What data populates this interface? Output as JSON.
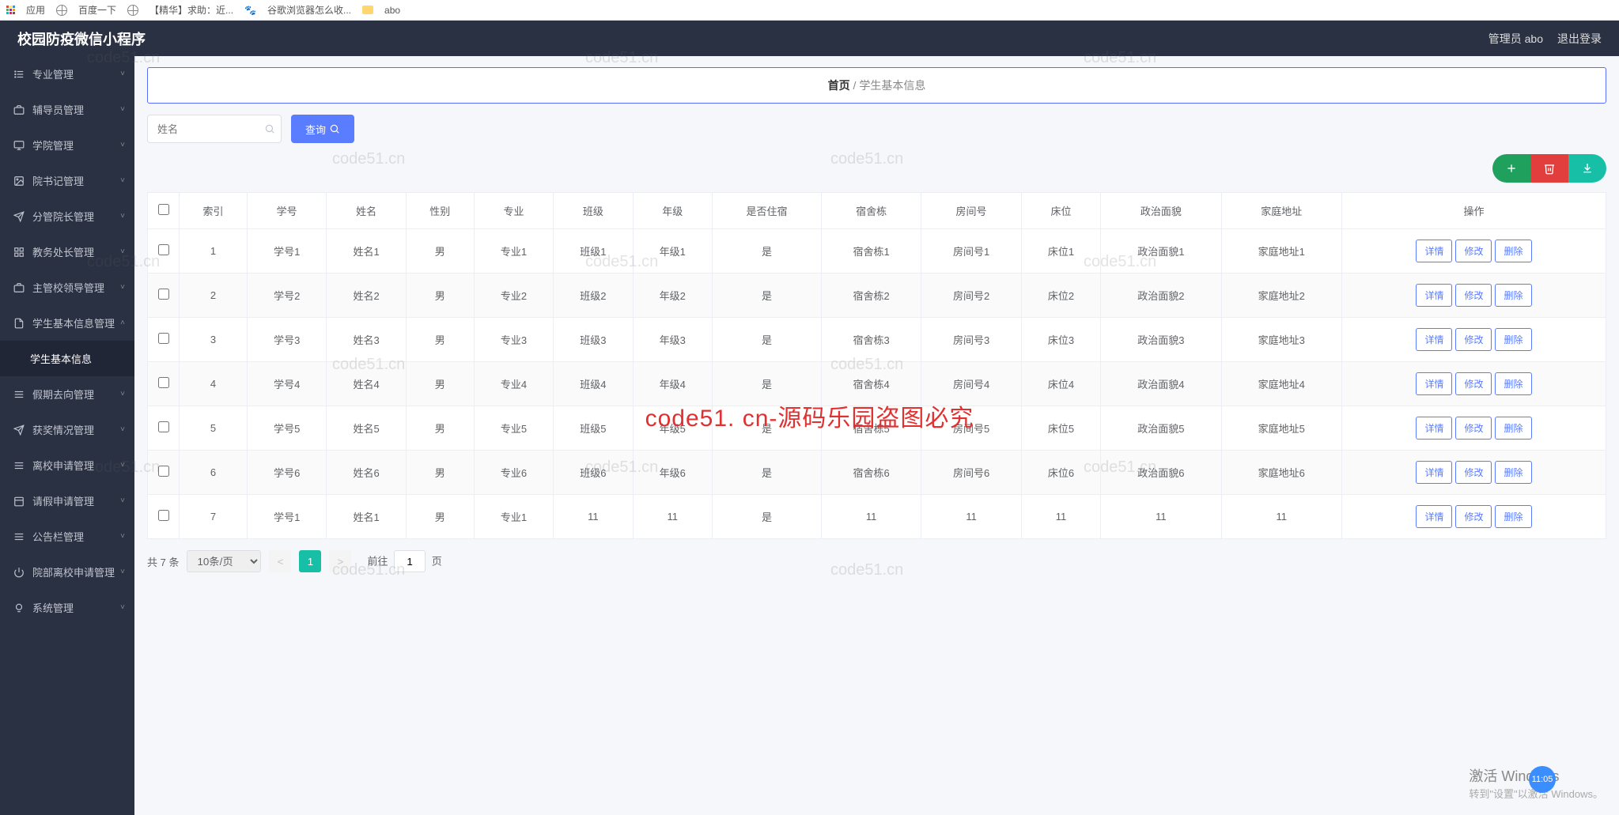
{
  "browser_bookmarks": {
    "apps": "应用",
    "baidu": "百度一下",
    "jinghua": "【精华】求助：近...",
    "chrome": "谷歌浏览器怎么收...",
    "abo": "abo"
  },
  "header": {
    "title": "校园防疫微信小程序",
    "user": "管理员 abo",
    "logout": "退出登录"
  },
  "sidebar": [
    {
      "label": "专业管理",
      "icon": "list"
    },
    {
      "label": "辅导员管理",
      "icon": "briefcase"
    },
    {
      "label": "学院管理",
      "icon": "monitor"
    },
    {
      "label": "院书记管理",
      "icon": "image"
    },
    {
      "label": "分管院长管理",
      "icon": "send"
    },
    {
      "label": "教务处长管理",
      "icon": "grid"
    },
    {
      "label": "主管校领导管理",
      "icon": "briefcase"
    },
    {
      "label": "学生基本信息管理",
      "icon": "file",
      "open": true,
      "children": [
        {
          "label": "学生基本信息"
        }
      ]
    },
    {
      "label": "假期去向管理",
      "icon": "lines"
    },
    {
      "label": "获奖情况管理",
      "icon": "send"
    },
    {
      "label": "离校申请管理",
      "icon": "lines"
    },
    {
      "label": "请假申请管理",
      "icon": "calendar"
    },
    {
      "label": "公告栏管理",
      "icon": "lines"
    },
    {
      "label": "院部离校申请管理",
      "icon": "power"
    },
    {
      "label": "系统管理",
      "icon": "bulb"
    }
  ],
  "breadcrumb": {
    "home": "首页",
    "sep": "/",
    "current": "学生基本信息"
  },
  "search": {
    "placeholder": "姓名",
    "button": "查询"
  },
  "table": {
    "headers": [
      "索引",
      "学号",
      "姓名",
      "性别",
      "专业",
      "班级",
      "年级",
      "是否住宿",
      "宿舍栋",
      "房间号",
      "床位",
      "政治面貌",
      "家庭地址",
      "操作"
    ],
    "rows": [
      {
        "idx": "1",
        "no": "学号1",
        "name": "姓名1",
        "sex": "男",
        "major": "专业1",
        "class": "班级1",
        "grade": "年级1",
        "dorm": "是",
        "building": "宿舍栋1",
        "room": "房间号1",
        "bed": "床位1",
        "pol": "政治面貌1",
        "addr": "家庭地址1"
      },
      {
        "idx": "2",
        "no": "学号2",
        "name": "姓名2",
        "sex": "男",
        "major": "专业2",
        "class": "班级2",
        "grade": "年级2",
        "dorm": "是",
        "building": "宿舍栋2",
        "room": "房间号2",
        "bed": "床位2",
        "pol": "政治面貌2",
        "addr": "家庭地址2"
      },
      {
        "idx": "3",
        "no": "学号3",
        "name": "姓名3",
        "sex": "男",
        "major": "专业3",
        "class": "班级3",
        "grade": "年级3",
        "dorm": "是",
        "building": "宿舍栋3",
        "room": "房间号3",
        "bed": "床位3",
        "pol": "政治面貌3",
        "addr": "家庭地址3"
      },
      {
        "idx": "4",
        "no": "学号4",
        "name": "姓名4",
        "sex": "男",
        "major": "专业4",
        "class": "班级4",
        "grade": "年级4",
        "dorm": "是",
        "building": "宿舍栋4",
        "room": "房间号4",
        "bed": "床位4",
        "pol": "政治面貌4",
        "addr": "家庭地址4"
      },
      {
        "idx": "5",
        "no": "学号5",
        "name": "姓名5",
        "sex": "男",
        "major": "专业5",
        "class": "班级5",
        "grade": "年级5",
        "dorm": "是",
        "building": "宿舍栋5",
        "room": "房间号5",
        "bed": "床位5",
        "pol": "政治面貌5",
        "addr": "家庭地址5"
      },
      {
        "idx": "6",
        "no": "学号6",
        "name": "姓名6",
        "sex": "男",
        "major": "专业6",
        "class": "班级6",
        "grade": "年级6",
        "dorm": "是",
        "building": "宿舍栋6",
        "room": "房间号6",
        "bed": "床位6",
        "pol": "政治面貌6",
        "addr": "家庭地址6"
      },
      {
        "idx": "7",
        "no": "学号1",
        "name": "姓名1",
        "sex": "男",
        "major": "专业1",
        "class": "11",
        "grade": "11",
        "dorm": "是",
        "building": "11",
        "room": "11",
        "bed": "11",
        "pol": "11",
        "addr": "11"
      }
    ],
    "ops": {
      "detail": "详情",
      "edit": "修改",
      "delete": "删除"
    }
  },
  "pagination": {
    "total_label": "共 7 条",
    "page_size": "10条/页",
    "current": "1",
    "goto_prefix": "前往",
    "goto_value": "1",
    "goto_suffix": "页"
  },
  "watermarks": [
    "code51.cn",
    "code51.cn",
    "code51.cn",
    "code51.cn",
    "code51.cn",
    "code51.cn",
    "code51.cn",
    "code51.cn",
    "code51.cn",
    "code51.cn"
  ],
  "center_text": "code51. cn-源码乐园盗图必究",
  "activate": {
    "t": "激活 Windows",
    "s": "转到\"设置\"以激活 Windows。"
  },
  "clock": "11:05"
}
